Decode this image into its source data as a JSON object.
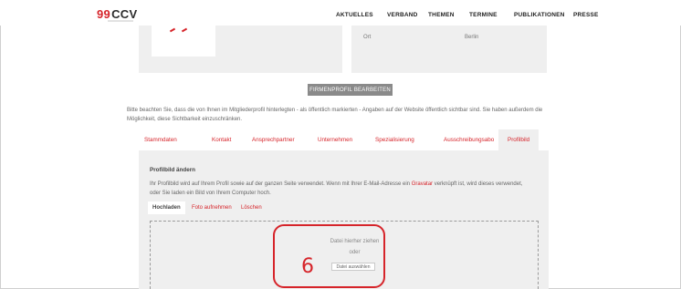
{
  "header": {
    "logo_quote": "99",
    "logo_text": "CCV",
    "nav": [
      "AKTUELLES",
      "VERBAND",
      "THEMEN",
      "TERMINE",
      "PUBLIKATIONEN",
      "PRESSE"
    ]
  },
  "profile": {
    "city_label": "Ort",
    "city_value": "Berlin"
  },
  "edit_button": "FIRMENPROFIL BEARBEITEN",
  "notice": "Bitte beachten Sie, dass die von Ihnen im Mitgliederprofil hinterlegten - als öffentlich markierten - Angaben auf der Website öffentlich sichtbar sind. Sie haben außerdem die Möglichkeit, diese Sichtbarkeit einzuschränken.",
  "tabs": [
    "Stammdaten",
    "Kontakt",
    "Ansprechpartner",
    "Unternehmen",
    "Spezialisierung",
    "Ausschreibungsabo",
    "Profilbild"
  ],
  "active_tab": "Profilbild",
  "panel": {
    "title": "Profilbild ändern",
    "text_before": "Ihr Profilbild wird auf Ihrem Profil sowie auf der ganzen Seite verwendet. Wenn mit Ihrer E-Mail-Adresse ein ",
    "text_link": "Gravatar",
    "text_after": " verknüpft ist, wird dieses verwendet, oder Sie laden ein Bild von Ihrem Computer hoch.",
    "subtabs": [
      "Hochladen",
      "Foto aufnehmen",
      "Löschen"
    ],
    "dropzone_line1": "Datei hierher ziehen",
    "dropzone_line2": "oder",
    "file_button": "Datei auswählen"
  },
  "annotation": {
    "number": "6"
  },
  "colors": {
    "accent": "#d6242a",
    "panel_bg": "#efefef",
    "button_bg": "#8a8a8a"
  }
}
